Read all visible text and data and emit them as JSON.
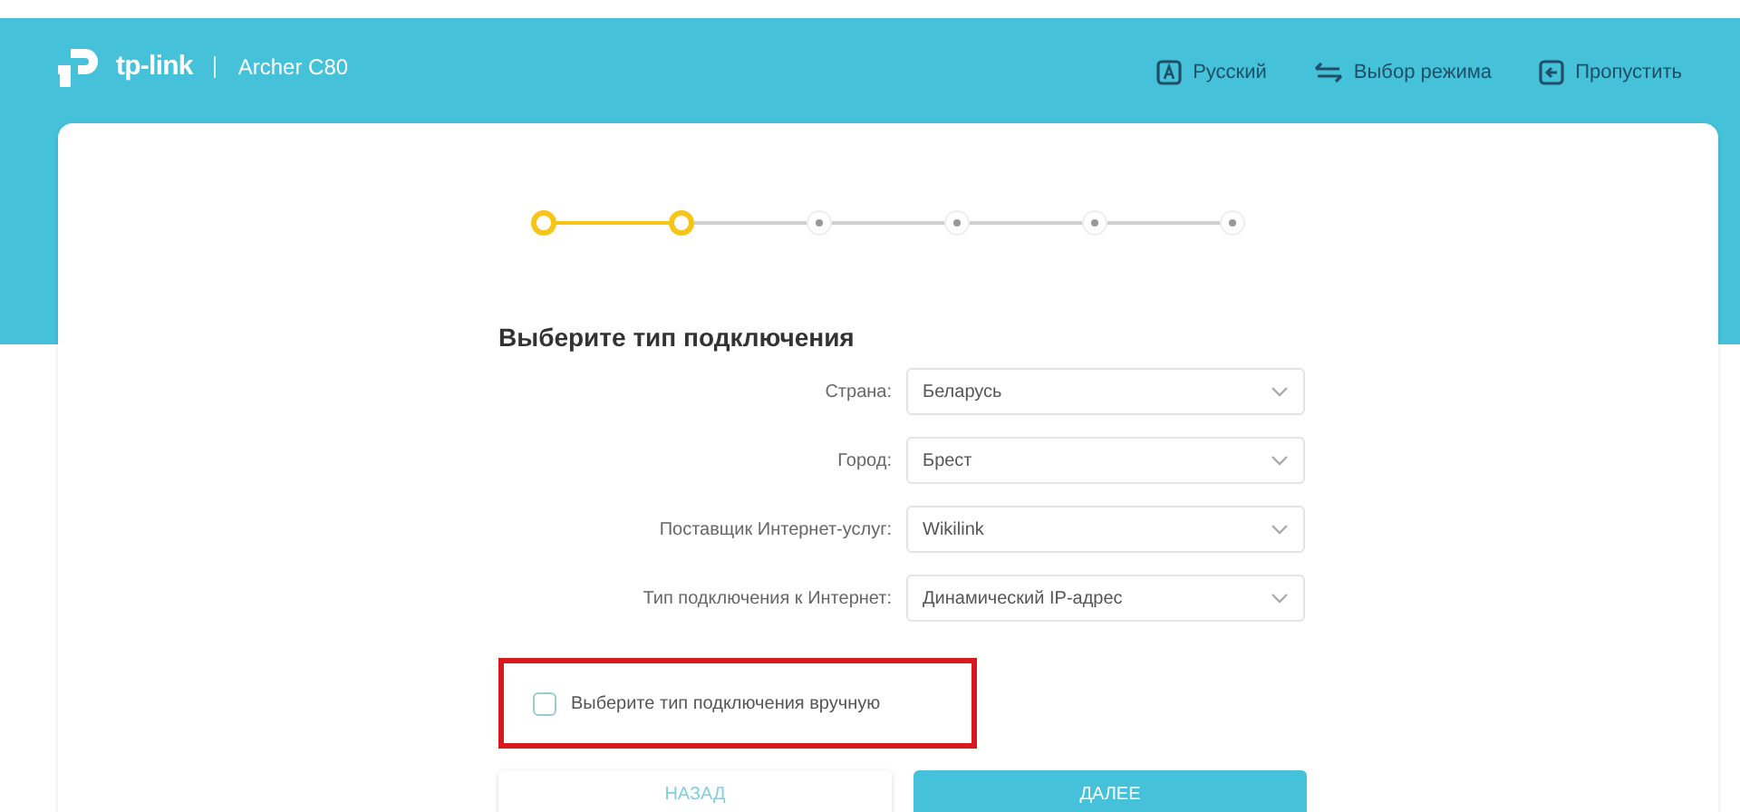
{
  "header": {
    "brand": "tp-link",
    "model": "Archer C80",
    "actions": [
      {
        "kind": "language",
        "label": "Русский"
      },
      {
        "kind": "mode",
        "label": "Выбор режима"
      },
      {
        "kind": "skip",
        "label": "Пропустить"
      }
    ]
  },
  "steps": [
    {
      "done": true
    },
    {
      "done": true
    },
    {
      "done": false
    },
    {
      "done": false
    },
    {
      "done": false
    },
    {
      "done": false
    }
  ],
  "form": {
    "title": "Выберите тип подключения",
    "fields": [
      {
        "label": "Страна:",
        "value": "Беларусь"
      },
      {
        "label": "Город:",
        "value": "Брест"
      },
      {
        "label": "Поставщик Интернет-услуг:",
        "value": "Wikilink"
      },
      {
        "label": "Тип подключения к Интернет:",
        "value": "Динамический IP-адрес"
      }
    ],
    "manual": {
      "label": "Выберите тип подключения вручную",
      "checked": false,
      "highlighted": true
    },
    "buttons": [
      {
        "kind": "secondary",
        "label": "НАЗАД"
      },
      {
        "kind": "primary",
        "label": "ДАЛЕЕ"
      }
    ]
  }
}
